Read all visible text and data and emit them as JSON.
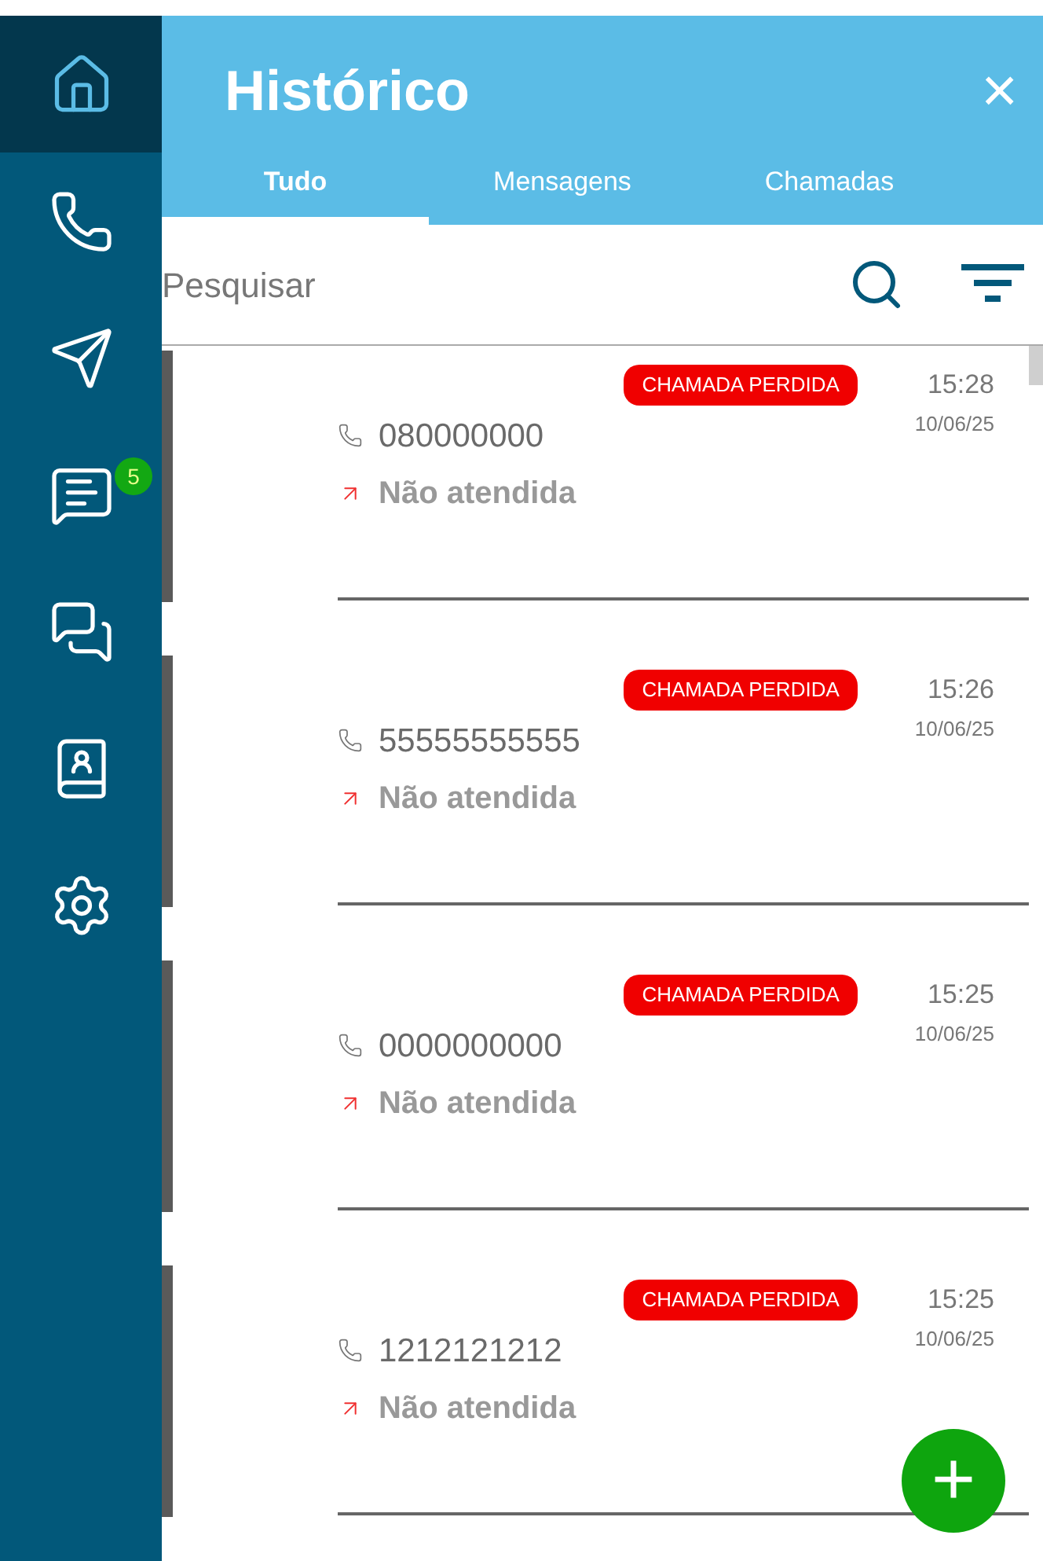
{
  "sidebar": {
    "items": [
      {
        "kind": "home",
        "selected": true
      },
      {
        "kind": "phone",
        "selected": false
      },
      {
        "kind": "send",
        "selected": false
      },
      {
        "kind": "messages",
        "selected": false,
        "badge": "5"
      },
      {
        "kind": "chats",
        "selected": false
      },
      {
        "kind": "contacts",
        "selected": false
      },
      {
        "kind": "settings",
        "selected": false
      }
    ]
  },
  "header": {
    "title": "Histórico",
    "close": "×"
  },
  "tabs": [
    {
      "label": "Tudo",
      "selected": true
    },
    {
      "label": "Mensagens",
      "selected": false
    },
    {
      "label": "Chamadas",
      "selected": false
    }
  ],
  "search": {
    "placeholder": "Pesquisar"
  },
  "calls": [
    {
      "badge": "CHAMADA PERDIDA",
      "number": "080000000",
      "status": "Não atendida",
      "time": "15:28",
      "date": "10/06/25"
    },
    {
      "badge": "CHAMADA PERDIDA",
      "number": "55555555555",
      "status": "Não atendida",
      "time": "15:26",
      "date": "10/06/25"
    },
    {
      "badge": "CHAMADA PERDIDA",
      "number": "0000000000",
      "status": "Não atendida",
      "time": "15:25",
      "date": "10/06/25"
    },
    {
      "badge": "CHAMADA PERDIDA",
      "number": "1212121212",
      "status": "Não atendida",
      "time": "15:25",
      "date": "10/06/25"
    }
  ],
  "fab": {
    "label": "+"
  }
}
